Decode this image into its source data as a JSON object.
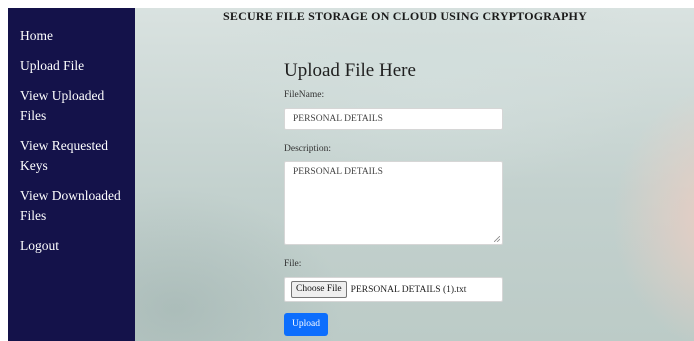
{
  "sidebar": {
    "items": [
      {
        "label": "Home"
      },
      {
        "label": "Upload File"
      },
      {
        "label": "View Uploaded Files"
      },
      {
        "label": "View Requested Keys"
      },
      {
        "label": "View Downloaded Files"
      },
      {
        "label": "Logout"
      }
    ]
  },
  "header": {
    "title": "SECURE FILE STORAGE ON CLOUD USING CRYPTOGRAPHY"
  },
  "form": {
    "heading": "Upload File Here",
    "filename_label": "FileName:",
    "filename_value": "PERSONAL DETAILS",
    "description_label": "Description:",
    "description_value": "PERSONAL DETAILS",
    "file_label": "File:",
    "choose_file_label": "Choose File",
    "chosen_file_name": "PERSONAL DETAILS (1).txt",
    "upload_label": "Upload"
  },
  "colors": {
    "sidebar_bg": "#14124a",
    "primary_button": "#0d6efd"
  }
}
